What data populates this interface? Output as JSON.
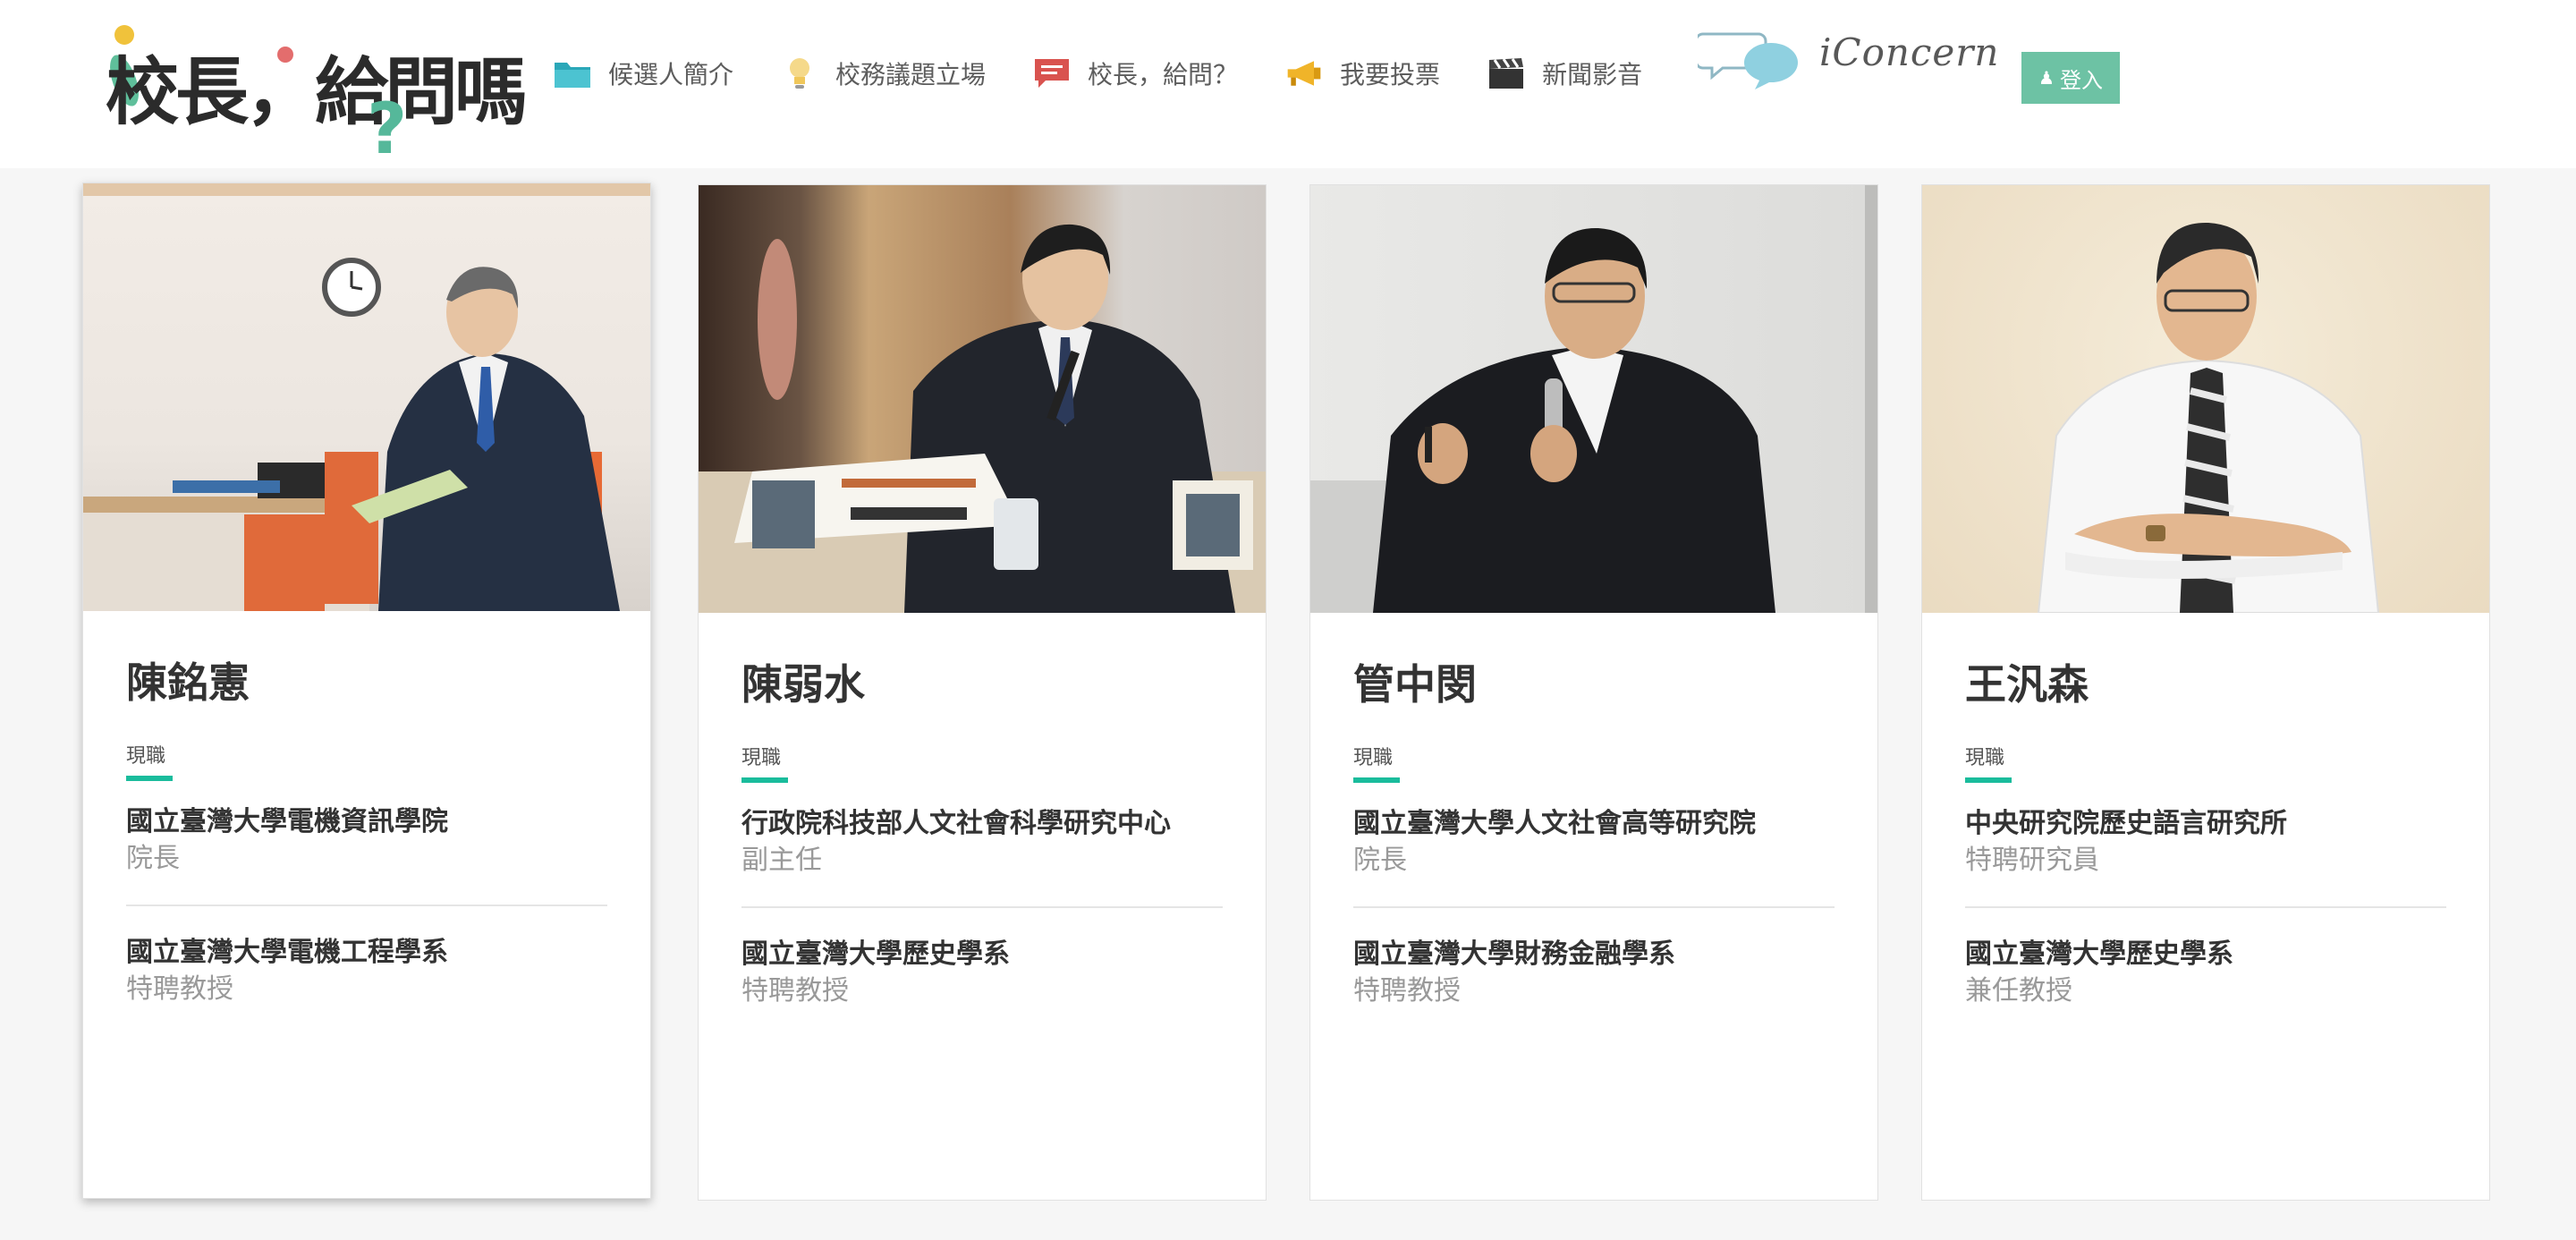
{
  "header": {
    "logo_text": "校長，給問嗎",
    "nav": [
      {
        "label": "候選人簡介",
        "icon": "folder-icon"
      },
      {
        "label": "校務議題立場",
        "icon": "lightbulb-icon"
      },
      {
        "label": "校長，給問？",
        "icon": "chat-icon"
      },
      {
        "label": "我要投票",
        "icon": "megaphone-icon"
      },
      {
        "label": "新聞影音",
        "icon": "clapperboard-icon"
      }
    ],
    "iconcern": "iConcern",
    "login_label": "登入"
  },
  "candidates": [
    {
      "name": "陳銘憲",
      "section_label": "現職",
      "jobs": [
        {
          "org": "國立臺灣大學電機資訊學院",
          "title": "院長"
        },
        {
          "org": "國立臺灣大學電機工程學系",
          "title": "特聘教授"
        }
      ]
    },
    {
      "name": "陳弱水",
      "section_label": "現職",
      "jobs": [
        {
          "org": "行政院科技部人文社會科學研究中心",
          "title": "副主任"
        },
        {
          "org": "國立臺灣大學歷史學系",
          "title": "特聘教授"
        }
      ]
    },
    {
      "name": "管中閔",
      "section_label": "現職",
      "jobs": [
        {
          "org": "國立臺灣大學人文社會高等研究院",
          "title": "院長"
        },
        {
          "org": "國立臺灣大學財務金融學系",
          "title": "特聘教授"
        }
      ]
    },
    {
      "name": "王汎森",
      "section_label": "現職",
      "jobs": [
        {
          "org": "中央研究院歷史語言研究所",
          "title": "特聘研究員"
        },
        {
          "org": "國立臺灣大學歷史學系",
          "title": "兼任教授"
        }
      ]
    }
  ],
  "colors": {
    "accent": "#1abc9c",
    "login_button": "#6dc2a4",
    "page_background": "#f6f6f6"
  }
}
